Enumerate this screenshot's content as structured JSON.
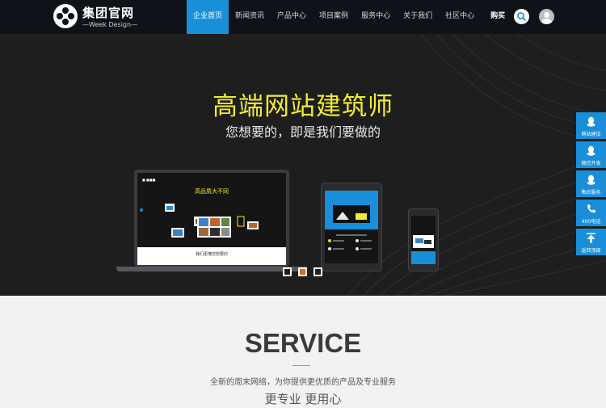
{
  "header": {
    "logo_title": "集团官网",
    "logo_subtitle": "—Week Design—",
    "nav": [
      {
        "label": "企业首页",
        "active": true
      },
      {
        "label": "新闻资讯"
      },
      {
        "label": "产品中心"
      },
      {
        "label": "项目案例"
      },
      {
        "label": "服务中心"
      },
      {
        "label": "关于我们"
      },
      {
        "label": "社区中心"
      }
    ],
    "buy_label": "购买",
    "search_icon": "search-icon",
    "avatar_icon": "user-avatar-icon"
  },
  "hero": {
    "title": "高端网站建筑师",
    "subtitle": "您想要的，即是我们要做的",
    "laptop_headline": "高品质大不同",
    "laptop_caption": "我们更懂您想要的",
    "slides": [
      {
        "active": false
      },
      {
        "active": true
      },
      {
        "active": false
      }
    ]
  },
  "side_float": [
    {
      "label": "网站建设",
      "icon": "qq-penguin-icon"
    },
    {
      "label": "微信开发",
      "icon": "qq-penguin-icon"
    },
    {
      "label": "售后服务",
      "icon": "qq-penguin-icon"
    },
    {
      "label": "400电话",
      "icon": "phone-icon"
    },
    {
      "label": "返回顶部",
      "icon": "arrow-up-icon"
    }
  ],
  "service": {
    "title": "SERVICE",
    "description": "全新的周末网络，为你提供更优质的产品及专业服务",
    "slogan": "更专业 更用心"
  },
  "colors": {
    "accent": "#1a8fd9",
    "hero_title": "#f2ec2f",
    "header_bg": "#0f1319",
    "hero_bg": "#1e1e1f",
    "active_dot": "#e06a1e"
  }
}
